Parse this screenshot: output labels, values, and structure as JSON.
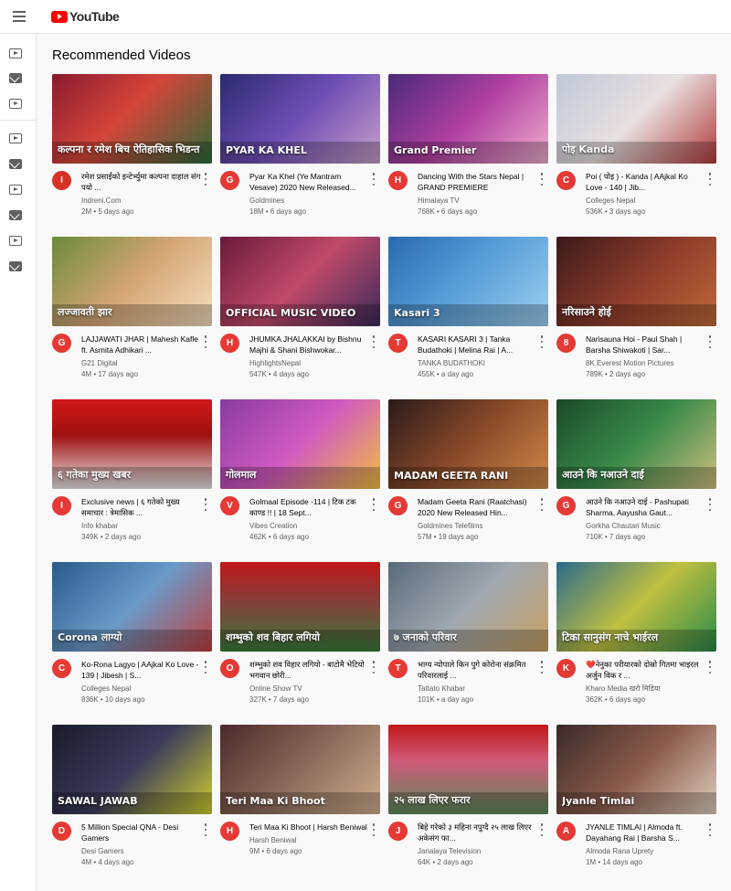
{
  "header": {
    "logo_text": "YouTube"
  },
  "sidebar": {
    "icons": [
      "play-square-icon",
      "mail-icon",
      "play-square-icon",
      "play-square-icon",
      "mail-icon",
      "play-square-icon",
      "mail-icon",
      "play-square-icon",
      "mail-icon"
    ]
  },
  "section_title": "Recommended Videos",
  "videos": [
    {
      "title": "रमेश प्रसाईंको इन्टेर्भ्युमा कल्पना दाहाल संग पयो ...",
      "channel": "Indreni.Com",
      "stats": "2M • 5 days ago",
      "avatar": "I",
      "avatar_color": "#d93025",
      "thumb_text": "कल्पना र रमेश बिच ऐतिहासिक भिडन्त",
      "thumb_bg": "linear-gradient(135deg,#8a1a2e,#d4453a 45%,#2b6b3a)"
    },
    {
      "title": "Pyar Ka Khel (Ye Mantram Vesave) 2020 New Released...",
      "channel": "Goldmines",
      "stats": "18M • 6 days ago",
      "avatar": "G",
      "avatar_color": "#e53935",
      "thumb_text": "PYAR KA KHEL",
      "thumb_bg": "linear-gradient(135deg,#2a2a6e,#6f4fb5 50%,#c9a0c8)"
    },
    {
      "title": "Dancing With the Stars Nepal | GRAND PREMIERE",
      "channel": "Himalaya TV",
      "stats": "768K • 6 days ago",
      "avatar": "H",
      "avatar_color": "#e53935",
      "thumb_text": "Grand Premier",
      "thumb_bg": "linear-gradient(135deg,#4a2a7a,#b03fa0 50%,#f0b0d0)"
    },
    {
      "title": "Poi ( पोइ ) - Kanda | AAjkal Ko Love - 140 | Jib...",
      "channel": "Colleges Nepal",
      "stats": "536K • 3 days ago",
      "avatar": "C",
      "avatar_color": "#e53935",
      "thumb_text": "पोइ Kanda",
      "thumb_bg": "linear-gradient(135deg,#c0c8d8,#e8e0e0 50%,#b33a3a)"
    },
    {
      "title": "LAJJAWATI JHAR | Mahesh Kafle ft. Asmita Adhikari ...",
      "channel": "G21 Digital",
      "stats": "4M • 17 days ago",
      "avatar": "G",
      "avatar_color": "#e53935",
      "thumb_text": "लज्जावती झार",
      "thumb_bg": "linear-gradient(135deg,#6a8a3a,#d4a574 50%,#f5e0c0)"
    },
    {
      "title": "JHUMKA JHALAKKAI by Bishnu Majhi & Shani Bishwokar...",
      "channel": "HighlightsNepal",
      "stats": "547K • 4 days ago",
      "avatar": "H",
      "avatar_color": "#e53935",
      "thumb_text": "OFFICIAL MUSIC VIDEO",
      "thumb_bg": "linear-gradient(135deg,#6a1a3a,#c04a6a 50%,#3a2a5a)"
    },
    {
      "title": "KASARI KASARI 3 | Tanka Budathoki | Melina Rai | A...",
      "channel": "TANKA BUDATHOKI",
      "stats": "455K • a day ago",
      "avatar": "T",
      "avatar_color": "#e53935",
      "thumb_text": "Kasari 3",
      "thumb_bg": "linear-gradient(135deg,#2a6ab0,#5aa0d8 50%,#a0d0f0)"
    },
    {
      "title": "Narisauna Hoi - Paul Shah | Barsha Shiwakoti | Sar...",
      "channel": "8K Everest Motion Pictures",
      "stats": "789K • 2 days ago",
      "avatar": "8",
      "avatar_color": "#e53935",
      "thumb_text": "नरिसाउने होई",
      "thumb_bg": "linear-gradient(135deg,#3a1a1a,#8a3a2a 50%,#c06a3a)"
    },
    {
      "title": "Exclusive news | ६ गतेको मुख्य समाचार : त्रेमासिक ...",
      "channel": "Info khabar",
      "stats": "349K • 2 days ago",
      "avatar": "I",
      "avatar_color": "#e53935",
      "thumb_text": "६ गतेका मुख्य खबर",
      "thumb_bg": "linear-gradient(180deg,#d01818,#a01010 40%,#e8e8e8)"
    },
    {
      "title": "Golmaal Episode -114 | टिक टक काण्ड !! | 18 Sept...",
      "channel": "Vibes Creation",
      "stats": "462K • 6 days ago",
      "avatar": "V",
      "avatar_color": "#e53935",
      "thumb_text": "गोलमाल",
      "thumb_bg": "linear-gradient(135deg,#8a3aa0,#d05ac0 50%,#f0c040)"
    },
    {
      "title": "Madam Geeta Rani (Raatchasi) 2020 New Released Hin...",
      "channel": "Goldmines Telefilms",
      "stats": "57M • 19 days ago",
      "avatar": "G",
      "avatar_color": "#e53935",
      "thumb_text": "MADAM GEETA RANI",
      "thumb_bg": "linear-gradient(135deg,#2a1a1a,#8a4a2a 50%,#d08a4a)"
    },
    {
      "title": "आउने कि नआउने दाई - Pashupati Sharma, Aayusha Gaut...",
      "channel": "Gorkha Chautari Music",
      "stats": "710K • 7 days ago",
      "avatar": "G",
      "avatar_color": "#e53935",
      "thumb_text": "आउने कि नआउने दाई",
      "thumb_bg": "linear-gradient(135deg,#1a4a2a,#3a8a4a 50%,#d0c080)"
    },
    {
      "title": "Ko-Rona Lagyo | AAjkal Ko Love - 139 | Jibesh | S...",
      "channel": "Colleges Nepal",
      "stats": "836K • 10 days ago",
      "avatar": "C",
      "avatar_color": "#e53935",
      "thumb_text": "Corona लाग्यो",
      "thumb_bg": "linear-gradient(135deg,#2a5a8a,#6a9ac8 50%,#c04040)"
    },
    {
      "title": "शम्भुको शव विहार लगियो - बाटोमै भेटियो भगवान छोरी...",
      "channel": "Online Show TV",
      "stats": "327K • 7 days ago",
      "avatar": "O",
      "avatar_color": "#e53935",
      "thumb_text": "शम्भुको शव बिहार लगियो",
      "thumb_bg": "linear-gradient(180deg,#c01818,#8a3a3a 40%,#3a7a3a)"
    },
    {
      "title": "भाग्य न्योपाले किन पुगे कोरोना संक्रमित परिवारलाई ...",
      "channel": "Tattato Khabar",
      "stats": "101K • a day ago",
      "avatar": "T",
      "avatar_color": "#e53935",
      "thumb_text": "७ जनाको परिवार",
      "thumb_bg": "linear-gradient(135deg,#5a6a7a,#a0a8b0 50%,#c8a060)"
    },
    {
      "title": "❤️नेनुका परीयारको दोस्रो गितमा भाइरल अर्जुन विक र ...",
      "channel": "Kharo Media खरो मिडिया",
      "stats": "362K • 6 days ago",
      "avatar": "K",
      "avatar_color": "#e53935",
      "thumb_text": "टिका सानुसंग नाचे भाईरल",
      "thumb_bg": "linear-gradient(135deg,#2a6a8a,#c0c040 50%,#2a8a4a)"
    },
    {
      "title": "5 Million Special QNA - Desi Gamers",
      "channel": "Desi Gamers",
      "stats": "4M • 4 days ago",
      "avatar": "D",
      "avatar_color": "#e53935",
      "thumb_text": "SAWAL JAWAB",
      "thumb_bg": "linear-gradient(135deg,#1a1a2a,#3a3a5a 50%,#d0d030)"
    },
    {
      "title": "Teri Maa Ki Bhoot | Harsh Beniwal",
      "channel": "Harsh Beniwal",
      "stats": "9M • 6 days ago",
      "avatar": "H",
      "avatar_color": "#e53935",
      "thumb_text": "Teri Maa Ki Bhoot",
      "thumb_bg": "linear-gradient(135deg,#4a2a2a,#8a6a5a 50%,#d0b090)"
    },
    {
      "title": "बिहे गरेको ३ महिना नपुग्दै २५ लाख लिएर अकेसंग फा...",
      "channel": "Janalaya Television",
      "stats": "64K • 2 days ago",
      "avatar": "J",
      "avatar_color": "#e53935",
      "thumb_text": "२५ लाख लिएर फरार",
      "thumb_bg": "linear-gradient(180deg,#c01818,#d05a7a 40%,#5a8a5a)"
    },
    {
      "title": "JYANLE TIMLAI | Almoda ft. Dayahang Rai | Barsha S...",
      "channel": "Almoda Rana Uprety",
      "stats": "1M • 14 days ago",
      "avatar": "A",
      "avatar_color": "#e53935",
      "thumb_text": "Jyanle Timlai",
      "thumb_bg": "linear-gradient(135deg,#3a2a2a,#8a5a4a 50%,#e0d0c0)"
    }
  ]
}
